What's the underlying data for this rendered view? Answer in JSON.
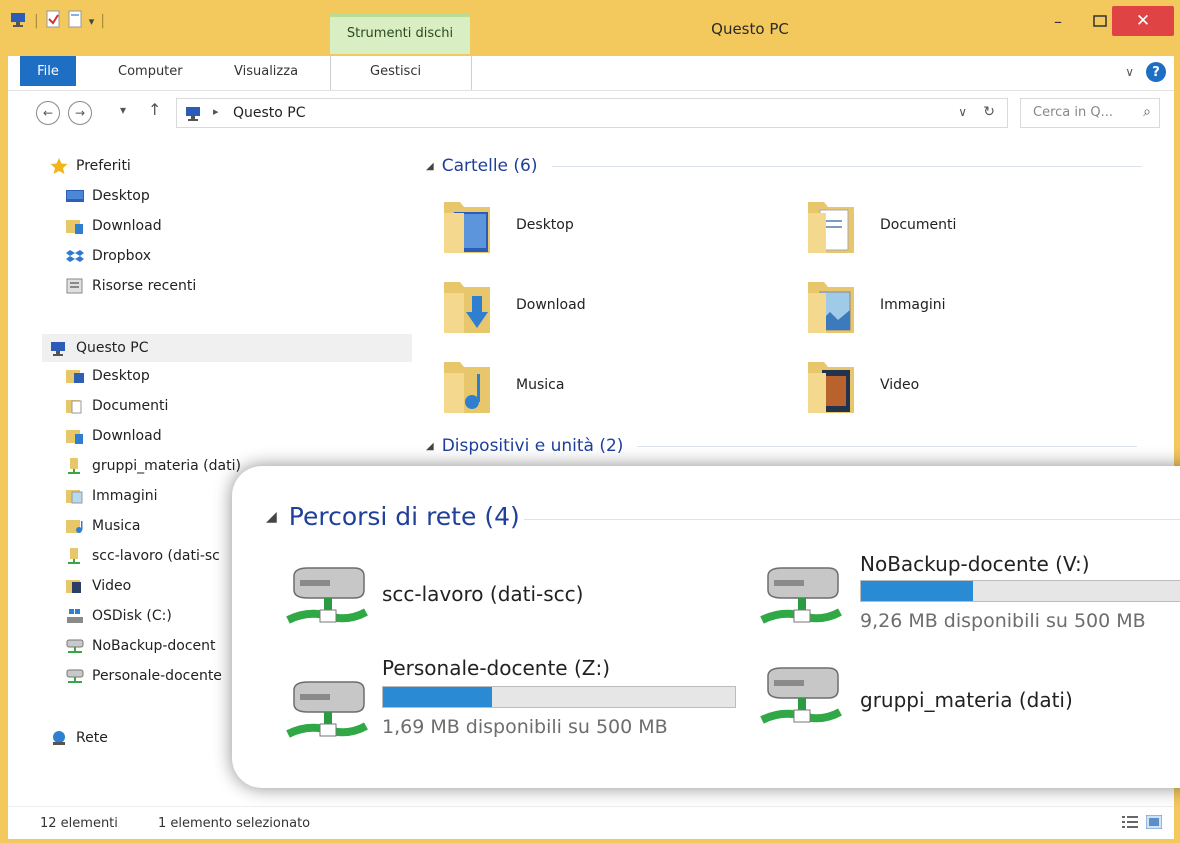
{
  "window": {
    "title": "Questo PC",
    "context_tab_group": "Strumenti dischi",
    "controls": {
      "minimize": "–",
      "maximize": "□",
      "close": "✕"
    }
  },
  "ribbon": {
    "tabs": [
      "File",
      "Computer",
      "Visualizza",
      "Gestisci"
    ],
    "help": "?"
  },
  "address": {
    "path": "Questo PC",
    "search_placeholder": "Cerca in Q..."
  },
  "nav": {
    "favorites_header": "Preferiti",
    "favorites": [
      "Desktop",
      "Download",
      "Dropbox",
      "Risorse recenti"
    ],
    "pc_header": "Questo PC",
    "pc_items": [
      "Desktop",
      "Documenti",
      "Download",
      "gruppi_materia (dati)",
      "Immagini",
      "Musica",
      "scc-lavoro (dati-sc",
      "Video",
      "OSDisk (C:)",
      "NoBackup-docent",
      "Personale-docente"
    ],
    "network": "Rete"
  },
  "content": {
    "folders_group": "Cartelle (6)",
    "folders": [
      "Desktop",
      "Documenti",
      "Download",
      "Immagini",
      "Musica",
      "Video"
    ],
    "devices_group": "Dispositivi e unità (2)"
  },
  "zoom": {
    "group": "Percorsi di rete (4)",
    "drives": [
      {
        "name": "scc-lavoro (dati-scc)"
      },
      {
        "name": "NoBackup-docente (V:)",
        "free": "9,26 MB disponibili su 500 MB",
        "used_fraction": 0.33
      },
      {
        "name": "Personale-docente (Z:)",
        "free": "1,69 MB disponibili su 500 MB",
        "used_fraction": 0.31
      },
      {
        "name": "gruppi_materia (dati)"
      }
    ]
  },
  "status": {
    "count": "12 elementi",
    "selection": "1 elemento selezionato"
  },
  "colors": {
    "titlebar": "#f3c85d",
    "file_tab": "#1e6fc4",
    "group_text": "#1e3f9a",
    "progress_fill": "#2a8ad4",
    "close_button": "#e04343"
  }
}
